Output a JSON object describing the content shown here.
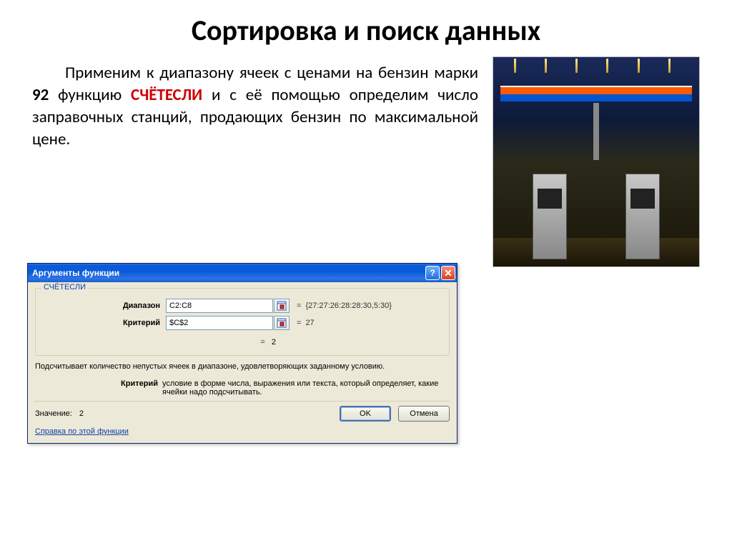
{
  "title": "Сортировка и поиск данных",
  "paragraph": {
    "pre": "Применим к диапазону ячеек с ценами на бензин марки ",
    "bold1": "92",
    "mid": " функцию ",
    "red": "СЧЁТЕСЛИ",
    "post": " и с её помощью определим число заправочных станций, продающих бензин по максимальной цене."
  },
  "dialog": {
    "title": "Аргументы функции",
    "help_icon": "?",
    "close_icon": "✕",
    "function_name": "СЧЁТЕСЛИ",
    "args": {
      "range_label": "Диапазон",
      "range_value": "C2:C8",
      "range_preview": "{27:27:26:28:28:30,5:30}",
      "criteria_label": "Критерий",
      "criteria_value": "$C$2",
      "criteria_preview": "27"
    },
    "eq": "=",
    "result_inline": "2",
    "description": "Подсчитывает количество непустых ячеек в диапазоне, удовлетворяющих заданному условию.",
    "arg_help_key": "Критерий",
    "arg_help_val": "условие в форме числа, выражения или текста, который определяет, какие ячейки надо подсчитывать.",
    "value_label": "Значение:",
    "value": "2",
    "help_link": "Справка по этой функции",
    "ok": "OK",
    "cancel": "Отмена"
  }
}
